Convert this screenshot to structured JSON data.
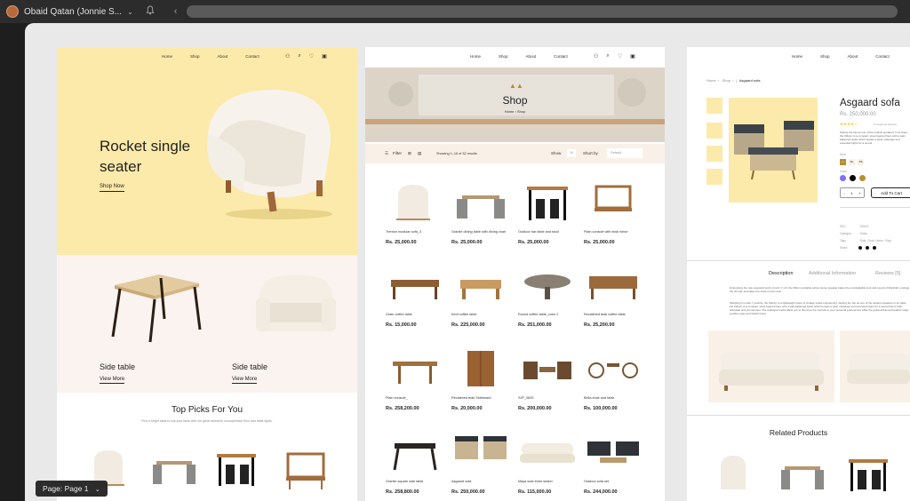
{
  "topbar": {
    "user_name": "Obaid Qatan (Jonnie S...",
    "chevron": "⌄",
    "bell": "🔔",
    "back": "‹",
    "forward": "›"
  },
  "page_chip": {
    "label": "Page: Page 1",
    "chevron": "⌄"
  },
  "nav": {
    "home": "Home",
    "shop": "Shop",
    "about": "About",
    "contact": "Contact"
  },
  "home": {
    "hero_title": "Rocket single seater",
    "shop_now": "Shop Now",
    "side_table_1": "Side table",
    "side_table_2": "Side table",
    "view_more_1": "View More",
    "view_more_2": "View More",
    "top_picks_title": "Top Picks For You",
    "top_picks_sub": "Find a bright ideal to suit your taste with our great selection of suspension floor and table lights."
  },
  "shop": {
    "banner_title": "Shop",
    "banner_crumb_home": "Home",
    "banner_crumb_shop": "Shop",
    "filter": "Filter",
    "results": "Showing 1–16 of 32 results",
    "show": "Show",
    "show_value": "16",
    "short_by": "Short by",
    "short_value": "Default",
    "products": [
      {
        "name": "Trenton modular sofa_3",
        "price": "Rs. 25,000.00"
      },
      {
        "name": "Granite dining table with dining chair",
        "price": "Rs. 25,000.00"
      },
      {
        "name": "Outdoor bar table and stool",
        "price": "Rs. 25,000.00"
      },
      {
        "name": "Plain console with teak mirror",
        "price": "Rs. 25,000.00"
      },
      {
        "name": "Grain coffee table",
        "price": "Rs. 15,000.00"
      },
      {
        "name": "Kent coffee table",
        "price": "Rs. 225,000.00"
      },
      {
        "name": "Round coffee table_color 2",
        "price": "Rs. 251,000.00"
      },
      {
        "name": "Reclaimed teak coffee table",
        "price": "Rs. 25,200.00"
      },
      {
        "name": "Plain console_",
        "price": "Rs. 258,200.00"
      },
      {
        "name": "Reclaimed teak Sideboard",
        "price": "Rs. 20,000.00"
      },
      {
        "name": "SJP_0825",
        "price": "Rs. 200,000.00"
      },
      {
        "name": "Bella chair and table",
        "price": "Rs. 100,000.00"
      },
      {
        "name": "Granite square side table",
        "price": "Rs. 258,800.00"
      },
      {
        "name": "Asgaard sofa",
        "price": "Rs. 250,000.00"
      },
      {
        "name": "Maya sofa three seater",
        "price": "Rs. 115,000.00"
      },
      {
        "name": "Outdoor sofa set",
        "price": "Rs. 244,000.00"
      }
    ]
  },
  "detail": {
    "crumb_home": "Home",
    "crumb_shop": "Shop",
    "crumb_item": "Asgaard sofa",
    "title": "Asgaard sofa",
    "price": "Rs. 250,000.00",
    "reviews": "5 Customer Review",
    "short_desc": "Setting the bar as one of the loudest speakers in its class, the Kilburn is a compact, stout-hearted hero with a well-balanced audio which boasts a clear midrange and extended highs for a sound.",
    "size_label": "Size",
    "sizes": [
      "L",
      "XL",
      "XS"
    ],
    "color_label": "Color",
    "colors": [
      "#816dfa",
      "#000000",
      "#b88e2f"
    ],
    "qty_minus": "-",
    "qty_value": "1",
    "qty_plus": "+",
    "add_to_cart": "Add To Cart",
    "sku_label": "SKU",
    "sku_value": ": SS001",
    "category_label": "Category",
    "category_value": ": Sofas",
    "tags_label": "Tags",
    "tags_value": ": Sofa, Chair, Home, Shop",
    "share_label": "Share",
    "tab_description": "Description",
    "tab_additional": "Additional Information",
    "tab_reviews": "Reviews [5]",
    "long_desc_1": "Embodying the raw, wayward spirit of rock 'n' roll, the Kilburn portable active stereo speaker takes the unmistakable look and sound of Marshall, unplugs the chords, and takes the show on the road.",
    "long_desc_2": "Weighing in under 7 pounds, the Kilburn is a lightweight piece of vintage styled engineering. Setting the bar as one of the loudest speakers in its class, the Kilburn is a compact, stout-hearted hero with a well-balanced audio which boasts a clear midrange and extended highs for a sound that is both articulate and pronounced. The analogue knobs allow you to fine tune the controls to your personal preferences while the guitar-influenced leather strap enables easy and stylish travel.",
    "related_title": "Related Products"
  },
  "colors": {
    "hero_bg": "#fbeaa9",
    "panel_bg": "#faf3f0",
    "filter_bg": "#f9f1e7",
    "accent": "#b88e2f"
  }
}
